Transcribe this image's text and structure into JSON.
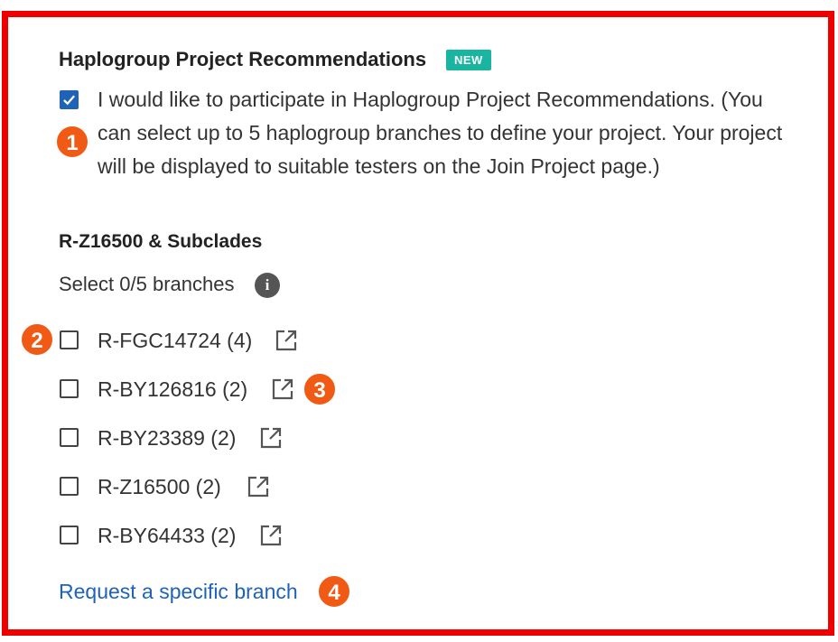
{
  "section": {
    "title": "Haplogroup Project Recommendations",
    "badge": "NEW"
  },
  "participate": {
    "checked": true,
    "line1": "I would like to participate in Haplogroup Project Recommendations. (You",
    "line2": "can select up to 5 haplogroup branches to define your project. Your project",
    "line3": "will be displayed to suitable testers on the Join Project page.)"
  },
  "subclades": {
    "title": "R-Z16500 & Subclades",
    "select_count": "Select 0/5 branches"
  },
  "branches": [
    {
      "label": "R-FGC14724 (4)",
      "checked": false
    },
    {
      "label": "R-BY126816 (2)",
      "checked": false
    },
    {
      "label": "R-BY23389 (2)",
      "checked": false
    },
    {
      "label": "R-Z16500 (2)",
      "checked": false
    },
    {
      "label": "R-BY64433 (2)",
      "checked": false
    }
  ],
  "request_link": "Request a specific branch",
  "markers": [
    "1",
    "2",
    "3",
    "4"
  ],
  "colors": {
    "frame": "#ee0000",
    "accent": "#1e63b8",
    "badge": "#19b5a0",
    "marker": "#f05a14"
  }
}
